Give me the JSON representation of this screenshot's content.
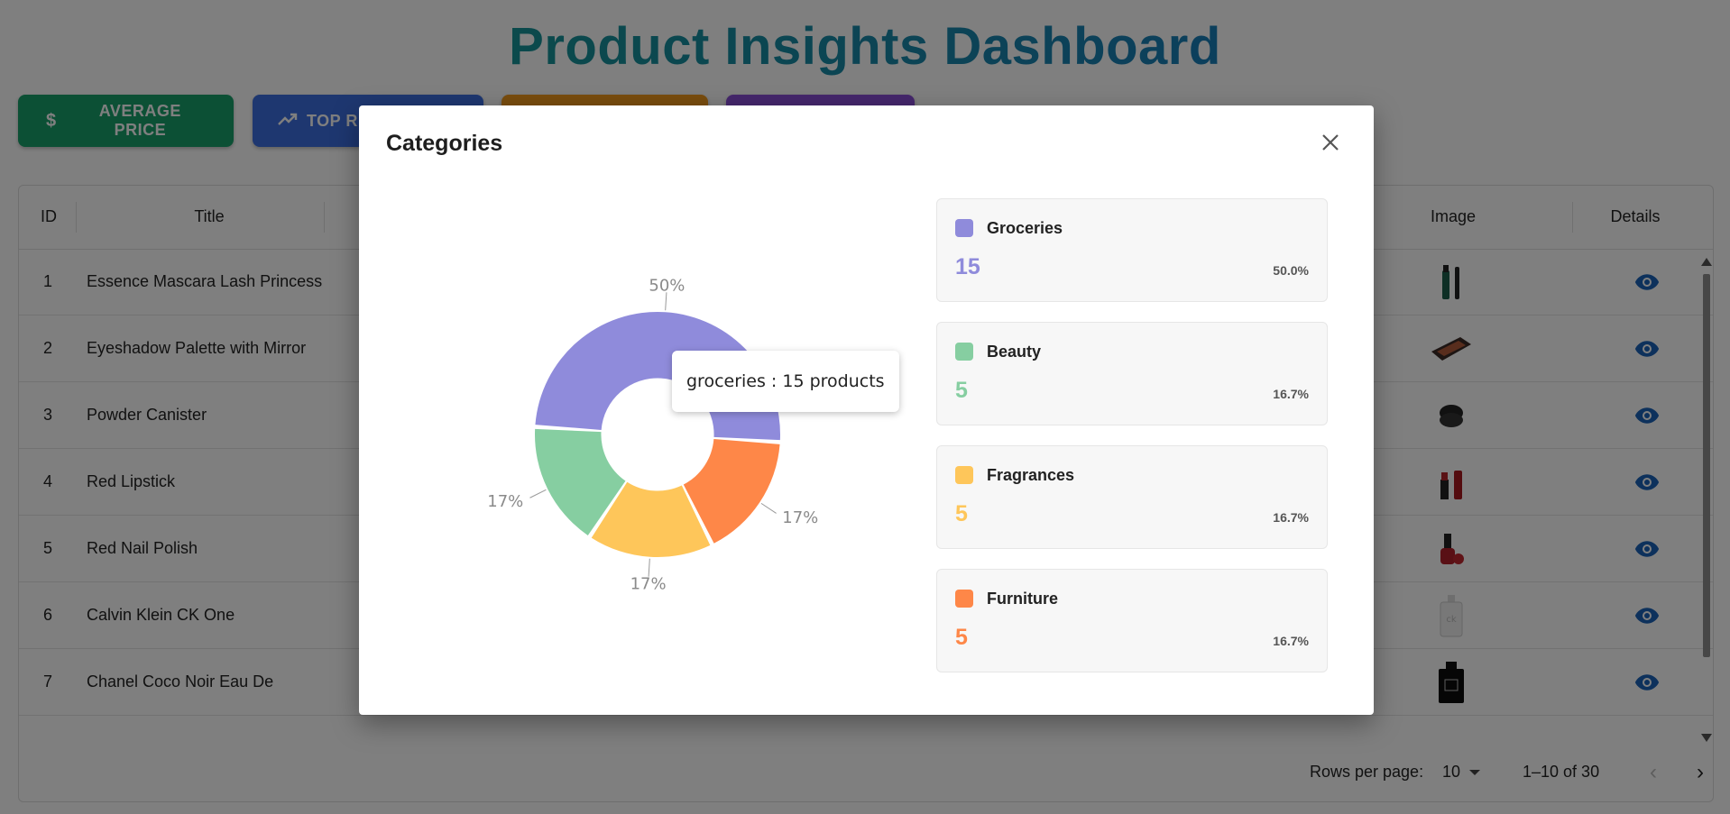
{
  "page": {
    "title": "Product Insights Dashboard"
  },
  "buttons": [
    {
      "label": "AVERAGE PRICE",
      "icon": "dollar-icon",
      "color": "#18a06a"
    },
    {
      "label": "TOP R",
      "icon": "trending-up-icon",
      "color": "#3d6fe0"
    },
    {
      "label": "",
      "icon": "",
      "color": "#f29a1d"
    },
    {
      "label": "",
      "icon": "",
      "color": "#8a4fd9"
    }
  ],
  "table": {
    "headers": {
      "id": "ID",
      "title": "Title",
      "image": "Image",
      "details": "Details"
    },
    "rows": [
      {
        "id": "1",
        "title": "Essence Mascara Lash Princess"
      },
      {
        "id": "2",
        "title": "Eyeshadow Palette with Mirror"
      },
      {
        "id": "3",
        "title": "Powder Canister"
      },
      {
        "id": "4",
        "title": "Red Lipstick"
      },
      {
        "id": "5",
        "title": "Red Nail Polish"
      },
      {
        "id": "6",
        "title": "Calvin Klein CK One"
      },
      {
        "id": "7",
        "title": "Chanel Coco Noir Eau De"
      }
    ],
    "footer": {
      "rows_per_page_label": "Rows per page:",
      "rows_per_page_value": "10",
      "range": "1–10 of 30"
    }
  },
  "modal": {
    "title": "Categories",
    "tooltip": "groceries : 15 products",
    "cards": [
      {
        "name": "Groceries",
        "count": "15",
        "percent": "50.0%",
        "color": "#8f8bdb"
      },
      {
        "name": "Beauty",
        "count": "5",
        "percent": "16.7%",
        "color": "#86cea1"
      },
      {
        "name": "Fragrances",
        "count": "5",
        "percent": "16.7%",
        "color": "#fec65a"
      },
      {
        "name": "Furniture",
        "count": "5",
        "percent": "16.7%",
        "color": "#fe8748"
      }
    ]
  },
  "chart_data": {
    "type": "pie",
    "categories": [
      "Groceries",
      "Beauty",
      "Fragrances",
      "Furniture"
    ],
    "values": [
      15,
      5,
      5,
      5
    ],
    "labels": [
      "50%",
      "17%",
      "17%",
      "17%"
    ],
    "colors": [
      "#8f8bdb",
      "#86cea1",
      "#fec65a",
      "#fe8748"
    ],
    "inner_radius_ratio": 0.46,
    "title": ""
  }
}
